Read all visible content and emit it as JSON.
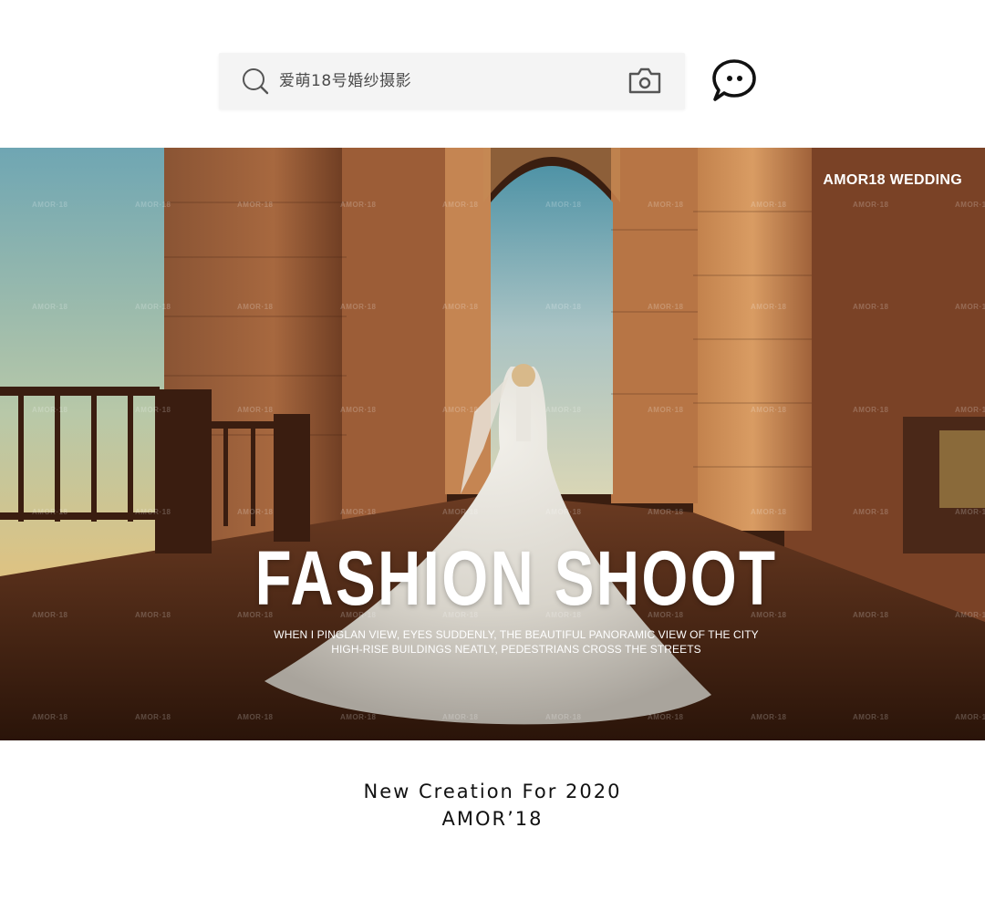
{
  "search": {
    "placeholder": "爱萌18号婚纱摄影",
    "search_icon": "search-icon",
    "camera_icon": "camera-icon"
  },
  "chat": {
    "icon": "chat-bubble-icon"
  },
  "banner": {
    "brand": "AMOR18  WEDDING",
    "headline": "FASHION SHOOT",
    "subline_1": "WHEN I PINGLAN VIEW, EYES SUDDENLY, THE BEAUTIFUL PANORAMIC VIEW OF THE CITY",
    "subline_2": "HIGH-RISE BUILDINGS NEATLY, PEDESTRIANS CROSS THE STREETS",
    "watermark": "AMOR·18"
  },
  "footer": {
    "line_1": "New Creation For 2020",
    "line_2": "AMOR’18"
  },
  "colors": {
    "background": "#ffffff",
    "search_bg": "#f4f4f4",
    "text_dark": "#111111",
    "banner_text": "#ffffff"
  }
}
